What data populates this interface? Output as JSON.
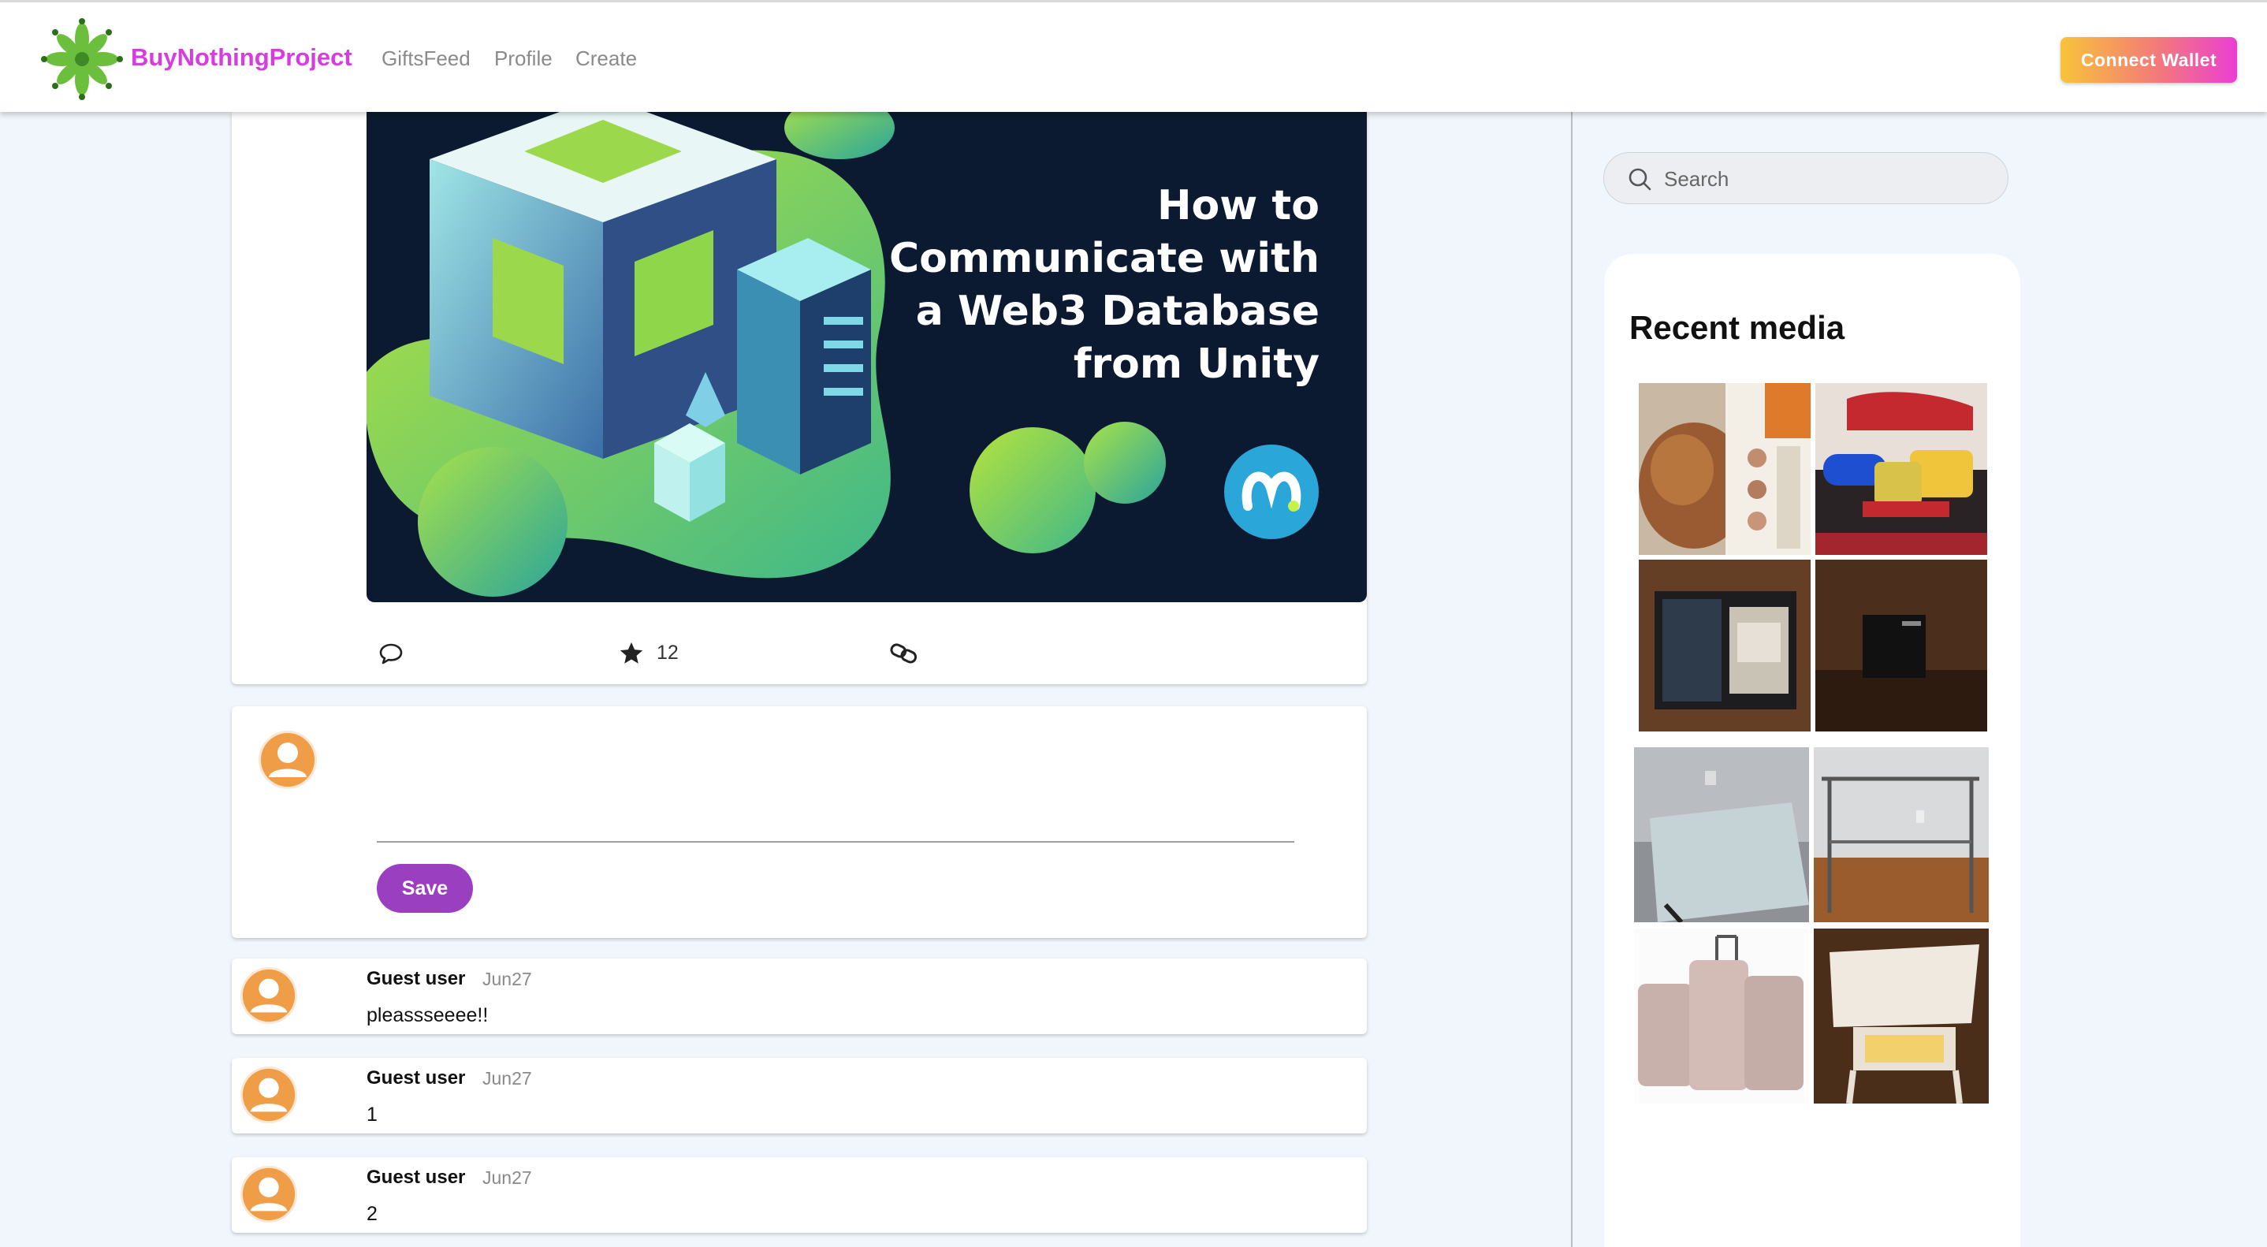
{
  "header": {
    "brand": "BuyNothingProject",
    "nav": [
      "GiftsFeed",
      "Profile",
      "Create"
    ],
    "connect_label": "Connect Wallet",
    "logo_icon": "snowflake-leaf-logo"
  },
  "post": {
    "banner_title_lines": [
      "How to",
      "Communicate with",
      "a Web3 Database",
      "from Unity"
    ],
    "star_count": "12",
    "icons": [
      "comment-icon",
      "star-icon",
      "link-icon"
    ]
  },
  "compose": {
    "save_label": "Save"
  },
  "comments": [
    {
      "author": "Guest user",
      "date": "Jun27",
      "text": "pleassseeee!!"
    },
    {
      "author": "Guest user",
      "date": "Jun27",
      "text": "1"
    },
    {
      "author": "Guest user",
      "date": "Jun27",
      "text": "2"
    }
  ],
  "sidebar": {
    "search_placeholder": "Search",
    "recent_media_title": "Recent media"
  },
  "colors": {
    "brand": "#d83be0",
    "save_button": "#9b3fc1",
    "avatar": "#ef9d46",
    "background": "#f0f6fc"
  }
}
